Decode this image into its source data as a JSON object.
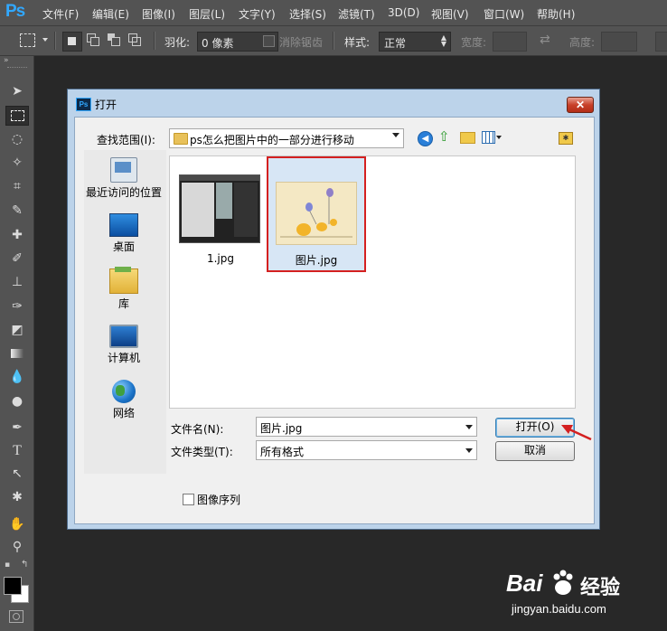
{
  "app": {
    "logo": "Ps",
    "menu": [
      "文件(F)",
      "编辑(E)",
      "图像(I)",
      "图层(L)",
      "文字(Y)",
      "选择(S)",
      "滤镜(T)",
      "3D(D)",
      "视图(V)",
      "窗口(W)",
      "帮助(H)"
    ]
  },
  "options_bar": {
    "feather_label": "羽化:",
    "feather_value": "0 像素",
    "antialias_label": "消除锯齿",
    "style_label": "样式:",
    "style_value": "正常",
    "width_label": "宽度:",
    "height_label": "高度:"
  },
  "dialog": {
    "title": "打开",
    "look_in_label": "查找范围(I):",
    "look_in_value": "ps怎么把图片中的一部分进行移动",
    "places": [
      "最近访问的位置",
      "桌面",
      "库",
      "计算机",
      "网络"
    ],
    "files": [
      {
        "name": "1.jpg",
        "selected": false
      },
      {
        "name": "图片.jpg",
        "selected": true
      }
    ],
    "filename_label": "文件名(N):",
    "filename_value": "图片.jpg",
    "filetype_label": "文件类型(T):",
    "filetype_value": "所有格式",
    "open_button": "打开(O)",
    "cancel_button": "取消",
    "image_sequence_label": "图像序列",
    "image_sequence_checked": false
  },
  "watermark": {
    "brand": "Bai",
    "brand_suffix": "经验",
    "url": "jingyan.baidu.com"
  },
  "colors": {
    "ps_blue": "#31a8ff",
    "highlight_red": "#d42020",
    "dialog_frame": "#bcd3ea"
  }
}
